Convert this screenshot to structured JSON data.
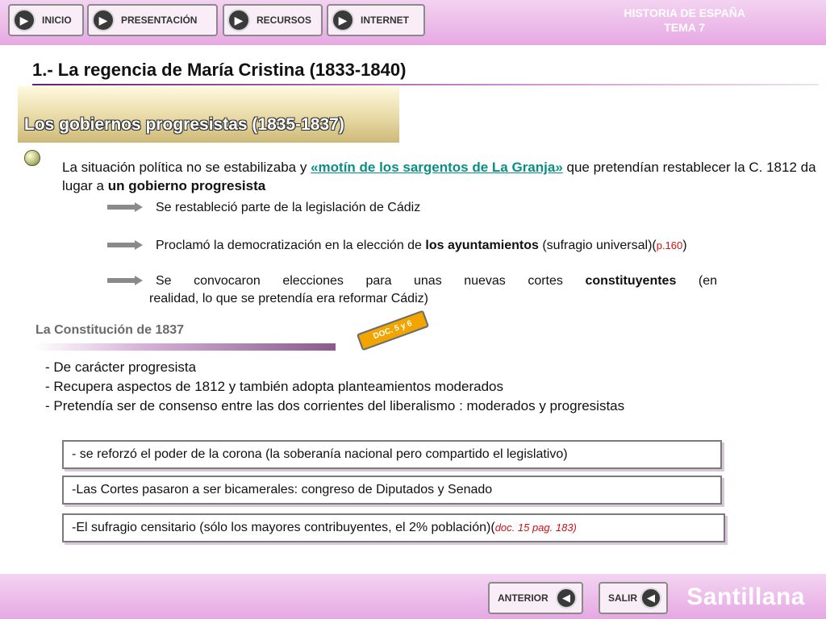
{
  "nav": {
    "inicio": "INICIO",
    "presentacion": "PRESENTACIÓN",
    "recursos": "RECURSOS",
    "internet": "INTERNET"
  },
  "header": {
    "line1": "HISTORIA DE ESPAÑA",
    "line2": "TEMA 7"
  },
  "title": "1.- La regencia de María Cristina (1833-1840)",
  "subtitle": "Los gobiernos progresistas (1835-1837)",
  "para": {
    "t1": "La situación política no se estabilizaba y ",
    "link": "«motín de los sargentos de La Granja»",
    "t2": " que pretendían restablecer la C. 1812 da lugar a ",
    "bold": "un gobierno progresista"
  },
  "points": {
    "p1": "Se restableció parte de la legislación de Cádiz",
    "p2_a": "Proclamó la democratización en la elección de ",
    "p2_b": "los ayuntamientos",
    "p2_c": " (sufragio  universal)(",
    "p2_ref": "p.160",
    "p2_d": ")",
    "p3_a": "Se convocaron elecciones para unas nuevas cortes ",
    "p3_b": "constituyentes",
    "p3_c": " (en",
    "p3_d": "realidad, lo que se pretendía era reformar Cádiz)"
  },
  "constitucion": {
    "heading": "La Constitución de 1837",
    "doc_badge": "DOC. 5 y 6",
    "items": [
      "- De carácter progresista",
      "- Recupera aspectos de 1812 y también adopta planteamientos moderados",
      "- Pretendía ser de consenso entre las dos corrientes del liberalismo : moderados y progresistas"
    ]
  },
  "boxes": {
    "b1": "-  se reforzó el poder de la corona (la soberanía nacional pero compartido el legislativo)",
    "b2": "-Las Cortes pasaron a ser bicamerales: congreso de Diputados y Senado",
    "b3_a": "-El sufragio censitario (sólo los mayores contribuyentes, el 2% población)(",
    "b3_ref": "doc. 15 pag. 183)"
  },
  "footer": {
    "anterior": "ANTERIOR",
    "salir": "SALIR",
    "brand": "Santillana"
  },
  "colors": {
    "accent": "#e6a8e3",
    "link": "#0a8f85",
    "ref": "#d01010",
    "badge": "#f0a500"
  },
  "icons": [
    "play-icon",
    "arrow-right-icon",
    "bullet-icon",
    "back-icon"
  ]
}
